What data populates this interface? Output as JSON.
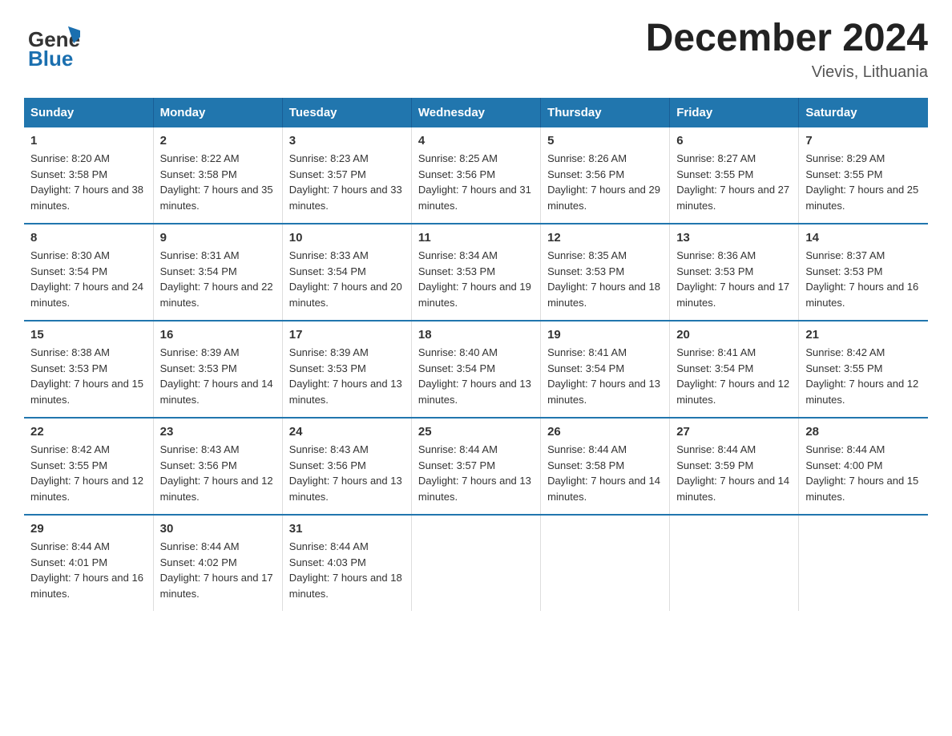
{
  "header": {
    "main_title": "December 2024",
    "subtitle": "Vievis, Lithuania",
    "logo_general": "General",
    "logo_blue": "Blue"
  },
  "calendar": {
    "days_of_week": [
      "Sunday",
      "Monday",
      "Tuesday",
      "Wednesday",
      "Thursday",
      "Friday",
      "Saturday"
    ],
    "weeks": [
      [
        {
          "day": "1",
          "sunrise": "8:20 AM",
          "sunset": "3:58 PM",
          "daylight": "7 hours and 38 minutes."
        },
        {
          "day": "2",
          "sunrise": "8:22 AM",
          "sunset": "3:58 PM",
          "daylight": "7 hours and 35 minutes."
        },
        {
          "day": "3",
          "sunrise": "8:23 AM",
          "sunset": "3:57 PM",
          "daylight": "7 hours and 33 minutes."
        },
        {
          "day": "4",
          "sunrise": "8:25 AM",
          "sunset": "3:56 PM",
          "daylight": "7 hours and 31 minutes."
        },
        {
          "day": "5",
          "sunrise": "8:26 AM",
          "sunset": "3:56 PM",
          "daylight": "7 hours and 29 minutes."
        },
        {
          "day": "6",
          "sunrise": "8:27 AM",
          "sunset": "3:55 PM",
          "daylight": "7 hours and 27 minutes."
        },
        {
          "day": "7",
          "sunrise": "8:29 AM",
          "sunset": "3:55 PM",
          "daylight": "7 hours and 25 minutes."
        }
      ],
      [
        {
          "day": "8",
          "sunrise": "8:30 AM",
          "sunset": "3:54 PM",
          "daylight": "7 hours and 24 minutes."
        },
        {
          "day": "9",
          "sunrise": "8:31 AM",
          "sunset": "3:54 PM",
          "daylight": "7 hours and 22 minutes."
        },
        {
          "day": "10",
          "sunrise": "8:33 AM",
          "sunset": "3:54 PM",
          "daylight": "7 hours and 20 minutes."
        },
        {
          "day": "11",
          "sunrise": "8:34 AM",
          "sunset": "3:53 PM",
          "daylight": "7 hours and 19 minutes."
        },
        {
          "day": "12",
          "sunrise": "8:35 AM",
          "sunset": "3:53 PM",
          "daylight": "7 hours and 18 minutes."
        },
        {
          "day": "13",
          "sunrise": "8:36 AM",
          "sunset": "3:53 PM",
          "daylight": "7 hours and 17 minutes."
        },
        {
          "day": "14",
          "sunrise": "8:37 AM",
          "sunset": "3:53 PM",
          "daylight": "7 hours and 16 minutes."
        }
      ],
      [
        {
          "day": "15",
          "sunrise": "8:38 AM",
          "sunset": "3:53 PM",
          "daylight": "7 hours and 15 minutes."
        },
        {
          "day": "16",
          "sunrise": "8:39 AM",
          "sunset": "3:53 PM",
          "daylight": "7 hours and 14 minutes."
        },
        {
          "day": "17",
          "sunrise": "8:39 AM",
          "sunset": "3:53 PM",
          "daylight": "7 hours and 13 minutes."
        },
        {
          "day": "18",
          "sunrise": "8:40 AM",
          "sunset": "3:54 PM",
          "daylight": "7 hours and 13 minutes."
        },
        {
          "day": "19",
          "sunrise": "8:41 AM",
          "sunset": "3:54 PM",
          "daylight": "7 hours and 13 minutes."
        },
        {
          "day": "20",
          "sunrise": "8:41 AM",
          "sunset": "3:54 PM",
          "daylight": "7 hours and 12 minutes."
        },
        {
          "day": "21",
          "sunrise": "8:42 AM",
          "sunset": "3:55 PM",
          "daylight": "7 hours and 12 minutes."
        }
      ],
      [
        {
          "day": "22",
          "sunrise": "8:42 AM",
          "sunset": "3:55 PM",
          "daylight": "7 hours and 12 minutes."
        },
        {
          "day": "23",
          "sunrise": "8:43 AM",
          "sunset": "3:56 PM",
          "daylight": "7 hours and 12 minutes."
        },
        {
          "day": "24",
          "sunrise": "8:43 AM",
          "sunset": "3:56 PM",
          "daylight": "7 hours and 13 minutes."
        },
        {
          "day": "25",
          "sunrise": "8:44 AM",
          "sunset": "3:57 PM",
          "daylight": "7 hours and 13 minutes."
        },
        {
          "day": "26",
          "sunrise": "8:44 AM",
          "sunset": "3:58 PM",
          "daylight": "7 hours and 14 minutes."
        },
        {
          "day": "27",
          "sunrise": "8:44 AM",
          "sunset": "3:59 PM",
          "daylight": "7 hours and 14 minutes."
        },
        {
          "day": "28",
          "sunrise": "8:44 AM",
          "sunset": "4:00 PM",
          "daylight": "7 hours and 15 minutes."
        }
      ],
      [
        {
          "day": "29",
          "sunrise": "8:44 AM",
          "sunset": "4:01 PM",
          "daylight": "7 hours and 16 minutes."
        },
        {
          "day": "30",
          "sunrise": "8:44 AM",
          "sunset": "4:02 PM",
          "daylight": "7 hours and 17 minutes."
        },
        {
          "day": "31",
          "sunrise": "8:44 AM",
          "sunset": "4:03 PM",
          "daylight": "7 hours and 18 minutes."
        },
        {
          "day": "",
          "sunrise": "",
          "sunset": "",
          "daylight": ""
        },
        {
          "day": "",
          "sunrise": "",
          "sunset": "",
          "daylight": ""
        },
        {
          "day": "",
          "sunrise": "",
          "sunset": "",
          "daylight": ""
        },
        {
          "day": "",
          "sunrise": "",
          "sunset": "",
          "daylight": ""
        }
      ]
    ]
  }
}
